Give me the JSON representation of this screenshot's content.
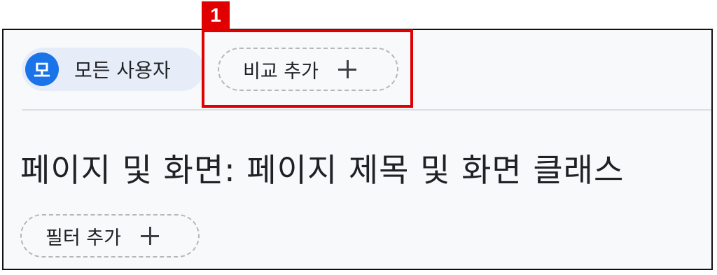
{
  "segments": {
    "all_users": {
      "avatar_letter": "모",
      "label": "모든 사용자"
    },
    "compare": {
      "label": "비교 추가"
    }
  },
  "page_title": "페이지 및 화면: 페이지 제목 및 화면 클래스",
  "filter": {
    "label": "필터 추가"
  },
  "annotation": {
    "badge": "1",
    "color": "#e00000"
  },
  "colors": {
    "avatar": "#1a73e8",
    "chip_bg": "#e7edf8",
    "text": "#202124"
  }
}
